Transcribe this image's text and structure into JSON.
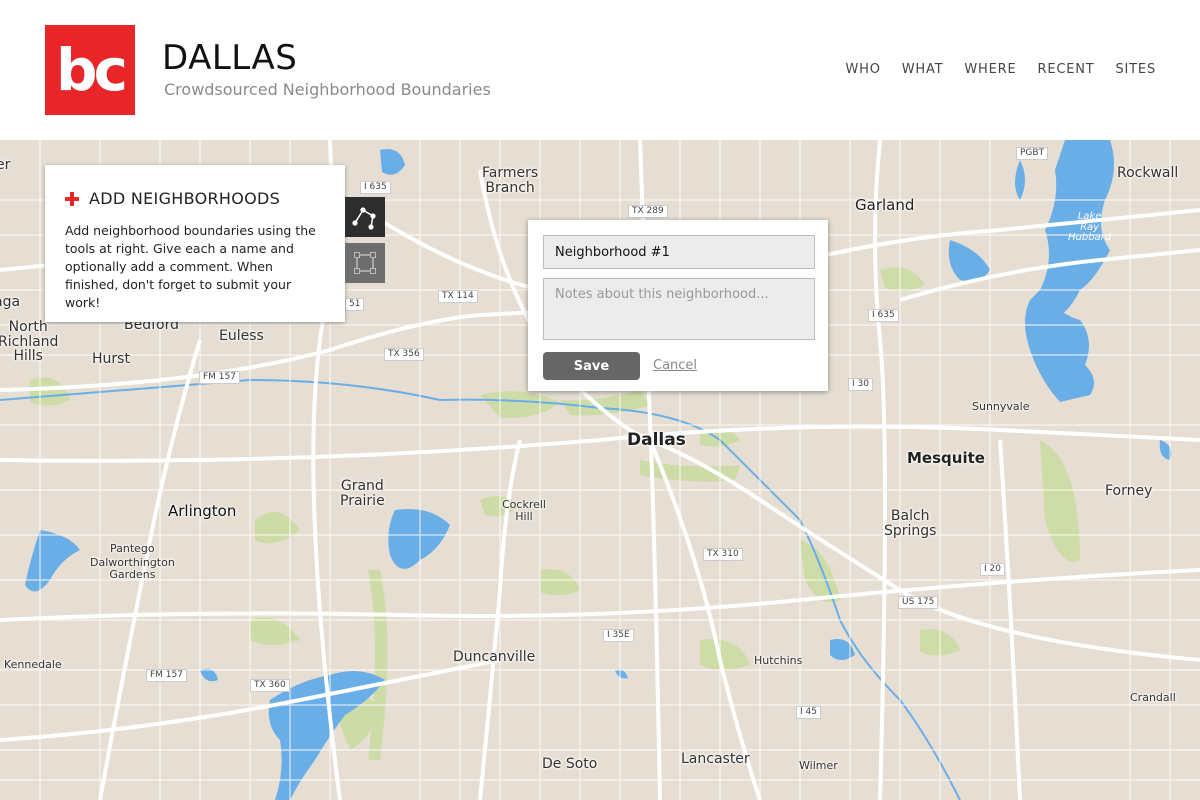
{
  "header": {
    "logo_text": "bc",
    "title": "DALLAS",
    "subtitle": "Crowdsourced Neighborhood Boundaries",
    "nav": [
      {
        "label": "WHO"
      },
      {
        "label": "WHAT"
      },
      {
        "label": "WHERE"
      },
      {
        "label": "RECENT"
      },
      {
        "label": "SITES"
      }
    ]
  },
  "panel": {
    "title": "ADD NEIGHBORHOODS",
    "instructions": "Add neighborhood boundaries using the tools at right. Give each a name and optionally add a comment. When finished, don't forget to submit your work!"
  },
  "tools": {
    "polygon_icon": "polygon-draw-icon",
    "rectangle_icon": "rectangle-draw-icon"
  },
  "popup": {
    "name_value": "Neighborhood #1",
    "notes_placeholder": "Notes about this neighborhood...",
    "save_label": "Save",
    "cancel_label": "Cancel"
  },
  "map": {
    "places": {
      "farmers_branch": "Farmers\nBranch",
      "garland": "Garland",
      "rockwall": "Rockwall",
      "lake_ray_hubbard": "Lake\nRay\nHubbard",
      "north_richland_hills": "North\nRichland\nHills",
      "bedford": "Bedford",
      "euless": "Euless",
      "hurst": "Hurst",
      "aga": "aga",
      "er": "er",
      "dallas": "Dallas",
      "mesquite": "Mesquite",
      "sunnyvale": "Sunnyvale",
      "forney": "Forney",
      "balch_springs": "Balch\nSprings",
      "arlington": "Arlington",
      "grand_prairie": "Grand\nPrairie",
      "cockrell_hill": "Cockrell\nHill",
      "pantego": "Pantego",
      "dalworthington_gardens": "Dalworthington\nGardens",
      "kennedale": "Kennedale",
      "duncanville": "Duncanville",
      "hutchins": "Hutchins",
      "crandall": "Crandall",
      "de_soto": "De Soto",
      "lancaster": "Lancaster",
      "wilmer": "Wilmer"
    },
    "shields": {
      "i635_w": "I 635",
      "tx289": "TX 289",
      "pgbt": "PGBT",
      "tx114": "TX 114",
      "sh161": "51",
      "tx356": "TX 356",
      "i635_e": "I 635",
      "i30": "I 30",
      "fm157_n": "FM 157",
      "tx310": "TX 310",
      "i20": "I 20",
      "us175": "US 175",
      "i35e": "I 35E",
      "fm157_s": "FM 157",
      "tx360": "TX 360",
      "i45": "I 45"
    },
    "colors": {
      "land": "#e6ded2",
      "water": "#6aaee8",
      "park": "#c9dca0",
      "road": "#ffffff",
      "accent": "#e8262a"
    }
  }
}
